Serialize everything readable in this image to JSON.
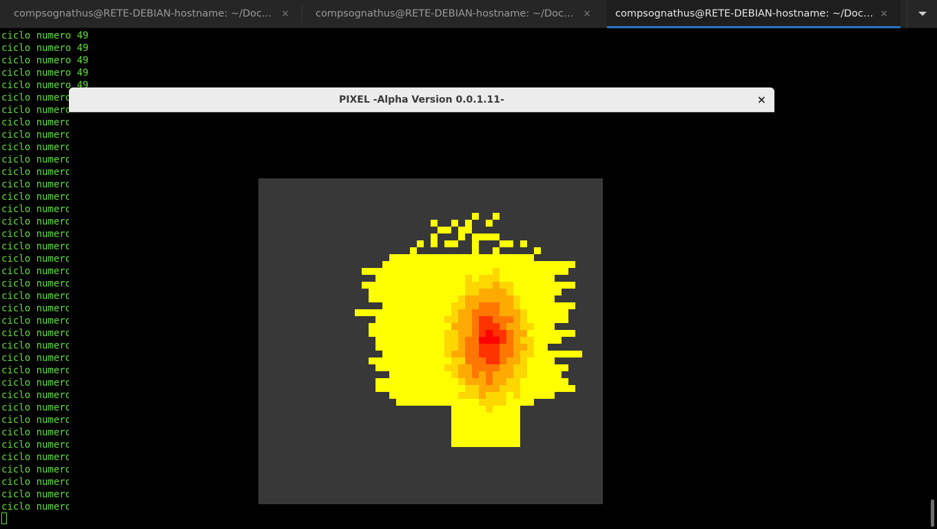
{
  "tabs": [
    {
      "title": "compsognathus@RETE-DEBIAN-hostname: ~/Documents",
      "close": "×",
      "active": false
    },
    {
      "title": "compsognathus@RETE-DEBIAN-hostname: ~/Documents",
      "close": "×",
      "active": false
    },
    {
      "title": "compsognathus@RETE-DEBIAN-hostname: ~/Documents",
      "close": "×",
      "active": true
    }
  ],
  "terminal": {
    "line_text": "ciclo numero 49",
    "line_count": 39,
    "text_color": "#5fe03a"
  },
  "pixel_window": {
    "title": "PIXEL -Alpha Version 0.0.1.11-",
    "close": "×",
    "canvas_background": "#383838",
    "palette": [
      "#ffff00",
      "#ffd700",
      "#ffaa00",
      "#ff7700",
      "#ff3300",
      "#ff0000"
    ]
  },
  "icons": {
    "menu": "chevron-down-icon",
    "tab_close": "close-icon",
    "window_close": "close-icon"
  }
}
